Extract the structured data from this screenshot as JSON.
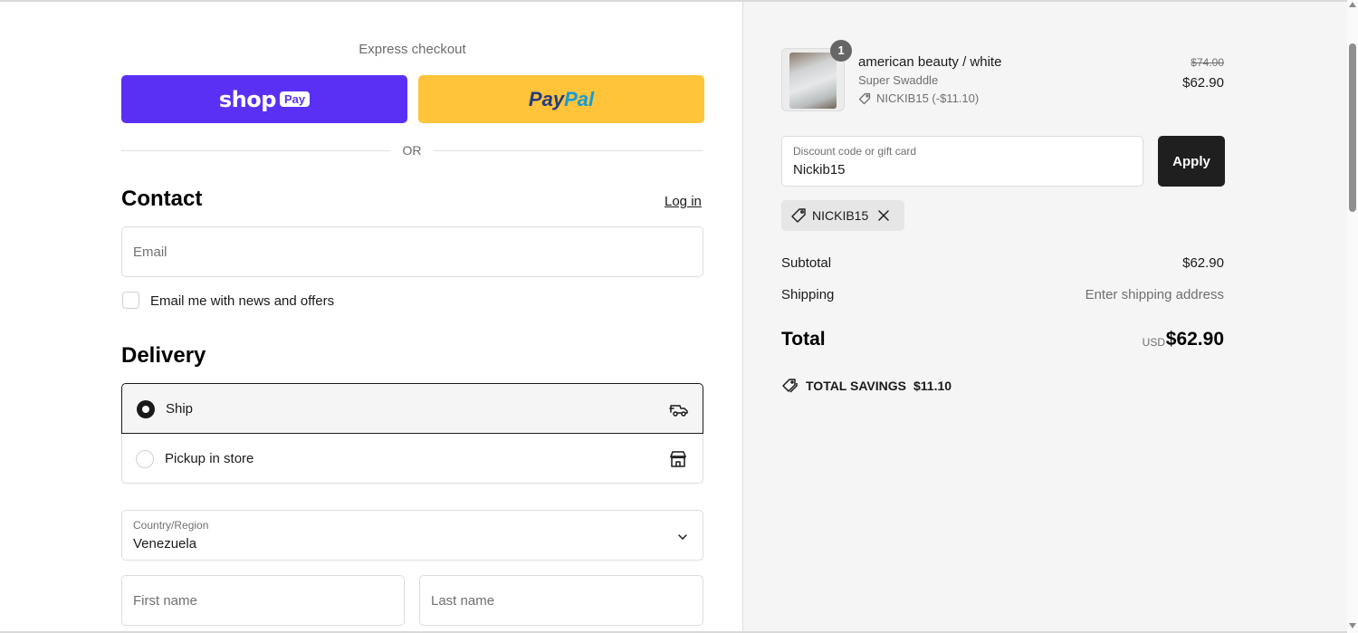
{
  "express": {
    "title": "Express checkout",
    "shop_word": "shop",
    "shop_pay_badge": "Pay",
    "paypal_part1": "Pay",
    "paypal_part2": "Pal",
    "or_text": "OR"
  },
  "contact": {
    "heading": "Contact",
    "login_link": "Log in",
    "email_placeholder": "Email",
    "news_checkbox_label": "Email me with news and offers",
    "news_checked": false
  },
  "delivery": {
    "heading": "Delivery",
    "options": [
      {
        "label": "Ship",
        "selected": true,
        "icon": "truck-icon"
      },
      {
        "label": "Pickup in store",
        "selected": false,
        "icon": "store-icon"
      }
    ],
    "country_label": "Country/Region",
    "country_value": "Venezuela",
    "first_name_placeholder": "First name",
    "last_name_placeholder": "Last name"
  },
  "cart": {
    "quantity": "1",
    "item_name": "american beauty / white",
    "item_variant": "Super Swaddle",
    "item_discount": "NICKIB15 (-$11.10)",
    "original_price": "$74.00",
    "sale_price": "$62.90"
  },
  "discount": {
    "field_label": "Discount code or gift card",
    "field_value": "Nickib15",
    "apply_label": "Apply",
    "applied_code": "NICKIB15"
  },
  "summary": {
    "subtotal_label": "Subtotal",
    "subtotal_value": "$62.90",
    "shipping_label": "Shipping",
    "shipping_value": "Enter shipping address",
    "total_label": "Total",
    "currency": "USD",
    "total_value": "$62.90",
    "savings_label": "TOTAL SAVINGS",
    "savings_value": "$11.10"
  },
  "colors": {
    "shop_pay": "#5a31f4",
    "paypal": "#ffc439",
    "apply_button": "#1f1f1f",
    "summary_bg": "#f5f5f5"
  }
}
